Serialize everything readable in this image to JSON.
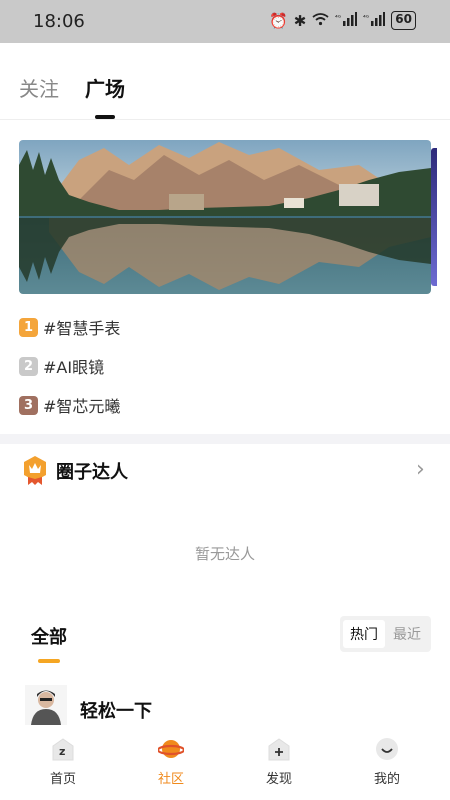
{
  "status_bar": {
    "time": "18:06",
    "signal_1": "⁴ᴳ",
    "signal_2": "⁴ᴳ",
    "battery": "60"
  },
  "tabs": {
    "follow_label": "关注",
    "square_label": "广场",
    "active": "广场"
  },
  "banner": {
    "image": "mountain lake landscape with reflection"
  },
  "trending": [
    {
      "rank": "1",
      "label": "#智慧手表"
    },
    {
      "rank": "2",
      "label": "#AI眼镜"
    },
    {
      "rank": "3",
      "label": "#智芯元曦"
    }
  ],
  "circle_experts": {
    "title": "圈子达人",
    "empty_text": "暂无达人"
  },
  "feed": {
    "title": "全部",
    "sort_hot": "热门",
    "sort_recent": "最近",
    "selected_sort": "热门",
    "posts": [
      {
        "title": "轻松一下"
      }
    ]
  },
  "bottom_nav": {
    "items": [
      {
        "label": "首页",
        "icon": "home-icon"
      },
      {
        "label": "社区",
        "icon": "planet-icon"
      },
      {
        "label": "发现",
        "icon": "discover-icon"
      },
      {
        "label": "我的",
        "icon": "profile-icon"
      }
    ],
    "active": "社区"
  },
  "colors": {
    "accent": "#f08a1c",
    "indicator": "#f5a623",
    "status_bar_bg": "#c9c9c9"
  }
}
